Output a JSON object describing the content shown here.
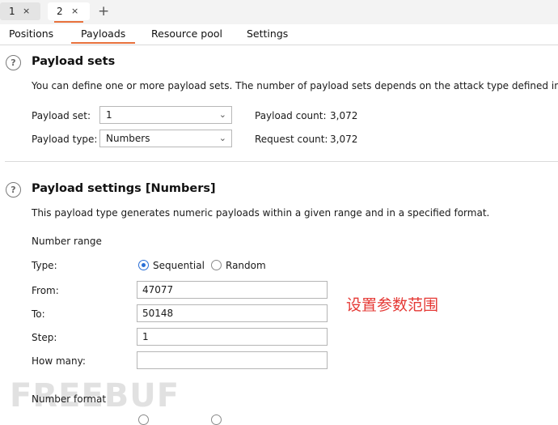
{
  "instance_tabs": [
    {
      "label": "1",
      "close": "×"
    },
    {
      "label": "2",
      "close": "×"
    }
  ],
  "new_tab": "+",
  "tabs": [
    "Positions",
    "Payloads",
    "Resource pool",
    "Settings"
  ],
  "help_glyph": "?",
  "payload_sets": {
    "title": "Payload sets",
    "description": "You can define one or more payload sets. The number of payload sets depends on the attack type defined in the",
    "set_label": "Payload set:",
    "set_value": "1",
    "type_label": "Payload type:",
    "type_value": "Numbers",
    "count_label": "Payload count:",
    "count_value": "3,072",
    "request_label": "Request count:",
    "request_value": "3,072"
  },
  "payload_settings": {
    "title": "Payload settings [Numbers]",
    "description": "This payload type generates numeric payloads within a given range and in a specified format.",
    "number_range": "Number range",
    "type_label": "Type:",
    "radio_sequential": "Sequential",
    "radio_random": "Random",
    "from_label": "From:",
    "from_value": "47077",
    "to_label": "To:",
    "to_value": "50148",
    "step_label": "Step:",
    "step_value": "1",
    "howmany_label": "How many:",
    "howmany_value": "",
    "number_format": "Number format"
  },
  "annotation": "设置参数范围",
  "watermark": "FREEBUF",
  "colors": {
    "accent": "#e8713c",
    "radio": "#2a6fd6",
    "annotation": "#e53935"
  }
}
